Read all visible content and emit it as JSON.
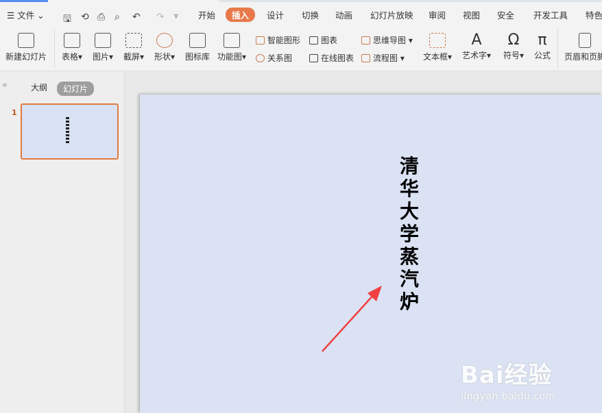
{
  "menu": {
    "file": "文件",
    "tabs": [
      "开始",
      "插入",
      "设计",
      "切换",
      "动画",
      "幻灯片放映",
      "审阅",
      "视图",
      "安全",
      "开发工具",
      "特色"
    ],
    "active_tab": "插入"
  },
  "ribbon": {
    "new_slide": "新建幻灯片",
    "table": "表格",
    "picture": "图片",
    "screenshot": "截屏",
    "shape": "形状",
    "icon_lib": "图标库",
    "func_chart": "功能图",
    "smart_art": "智能图形",
    "relation": "关系图",
    "chart": "图表",
    "online_chart": "在线图表",
    "mind_map": "思维导图",
    "flow_chart": "流程图",
    "textbox": "文本框",
    "word_art": "艺术字",
    "symbol": "符号",
    "formula": "公式",
    "header_footer": "页眉和页脚"
  },
  "panel": {
    "outline_tab": "大纲",
    "slides_tab": "幻灯片",
    "slide_number": "1"
  },
  "slide": {
    "text": "清华大学蒸汽炉",
    "background": "#dae2f3"
  },
  "annotation": {
    "arrow_color": "#f04040"
  },
  "watermark": {
    "brand": "Bai经验",
    "url": "jingyan.baidu.com"
  },
  "colors": {
    "accent": "#e8784a"
  }
}
